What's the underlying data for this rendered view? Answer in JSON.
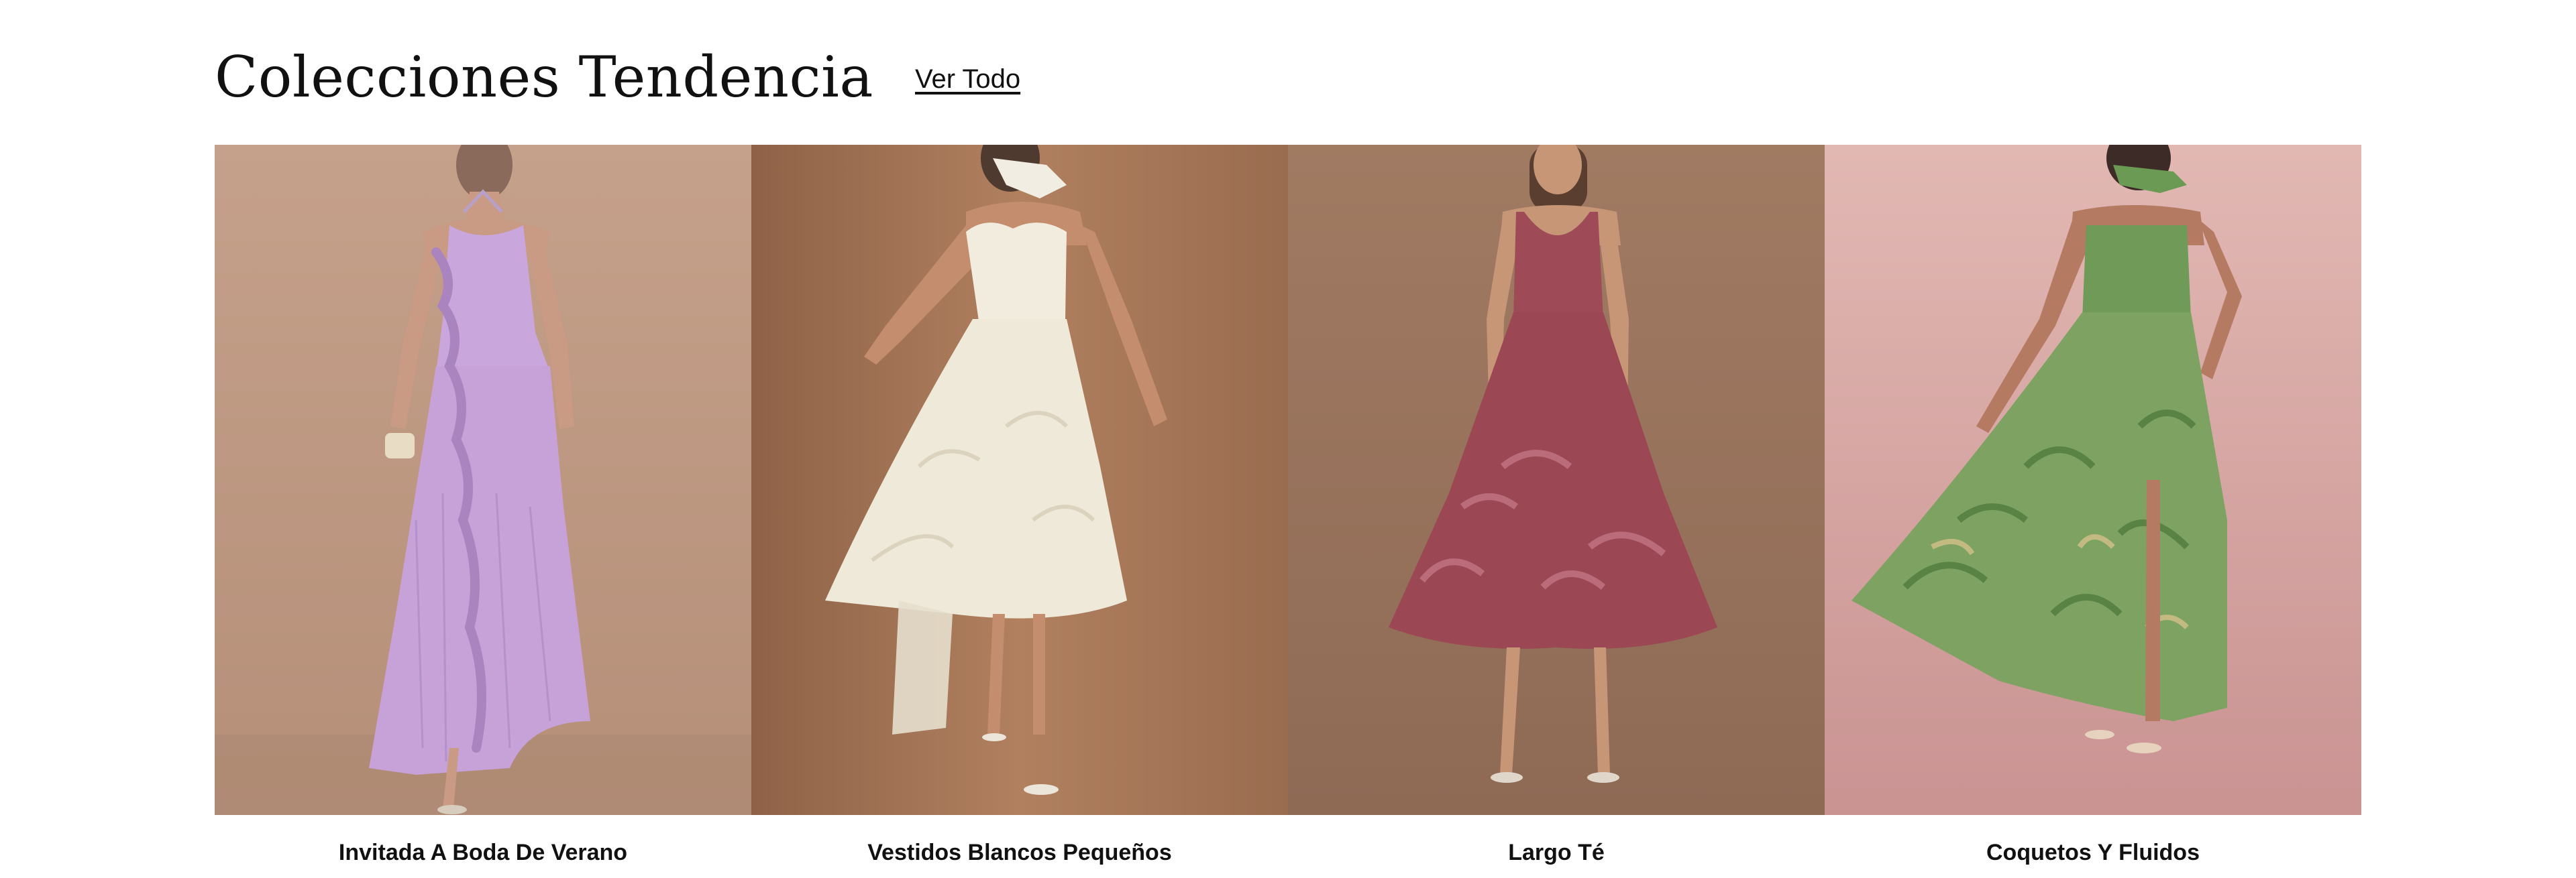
{
  "header": {
    "title": "Colecciones Tendencia",
    "view_all_label": "Ver Todo"
  },
  "collections": [
    {
      "label": "Invitada A Boda De Verano",
      "image_icon": "lilac-ruffle-maxi-dress-photo",
      "background_color": "#c9a48c",
      "dress_color": "#c9a6dc"
    },
    {
      "label": "Vestidos Blancos Pequeños",
      "image_icon": "ivory-strapless-midi-dress-photo",
      "background_color": "#a8775a",
      "dress_color": "#f1ecdd"
    },
    {
      "label": "Largo Té",
      "image_icon": "berry-jacquard-midi-dress-photo",
      "background_color": "#a9826a",
      "dress_color": "#9e4b57"
    },
    {
      "label": "Coquetos Y Fluidos",
      "image_icon": "green-floral-maxi-dress-photo",
      "background_color": "#d8aba6",
      "dress_color": "#7da262"
    }
  ]
}
